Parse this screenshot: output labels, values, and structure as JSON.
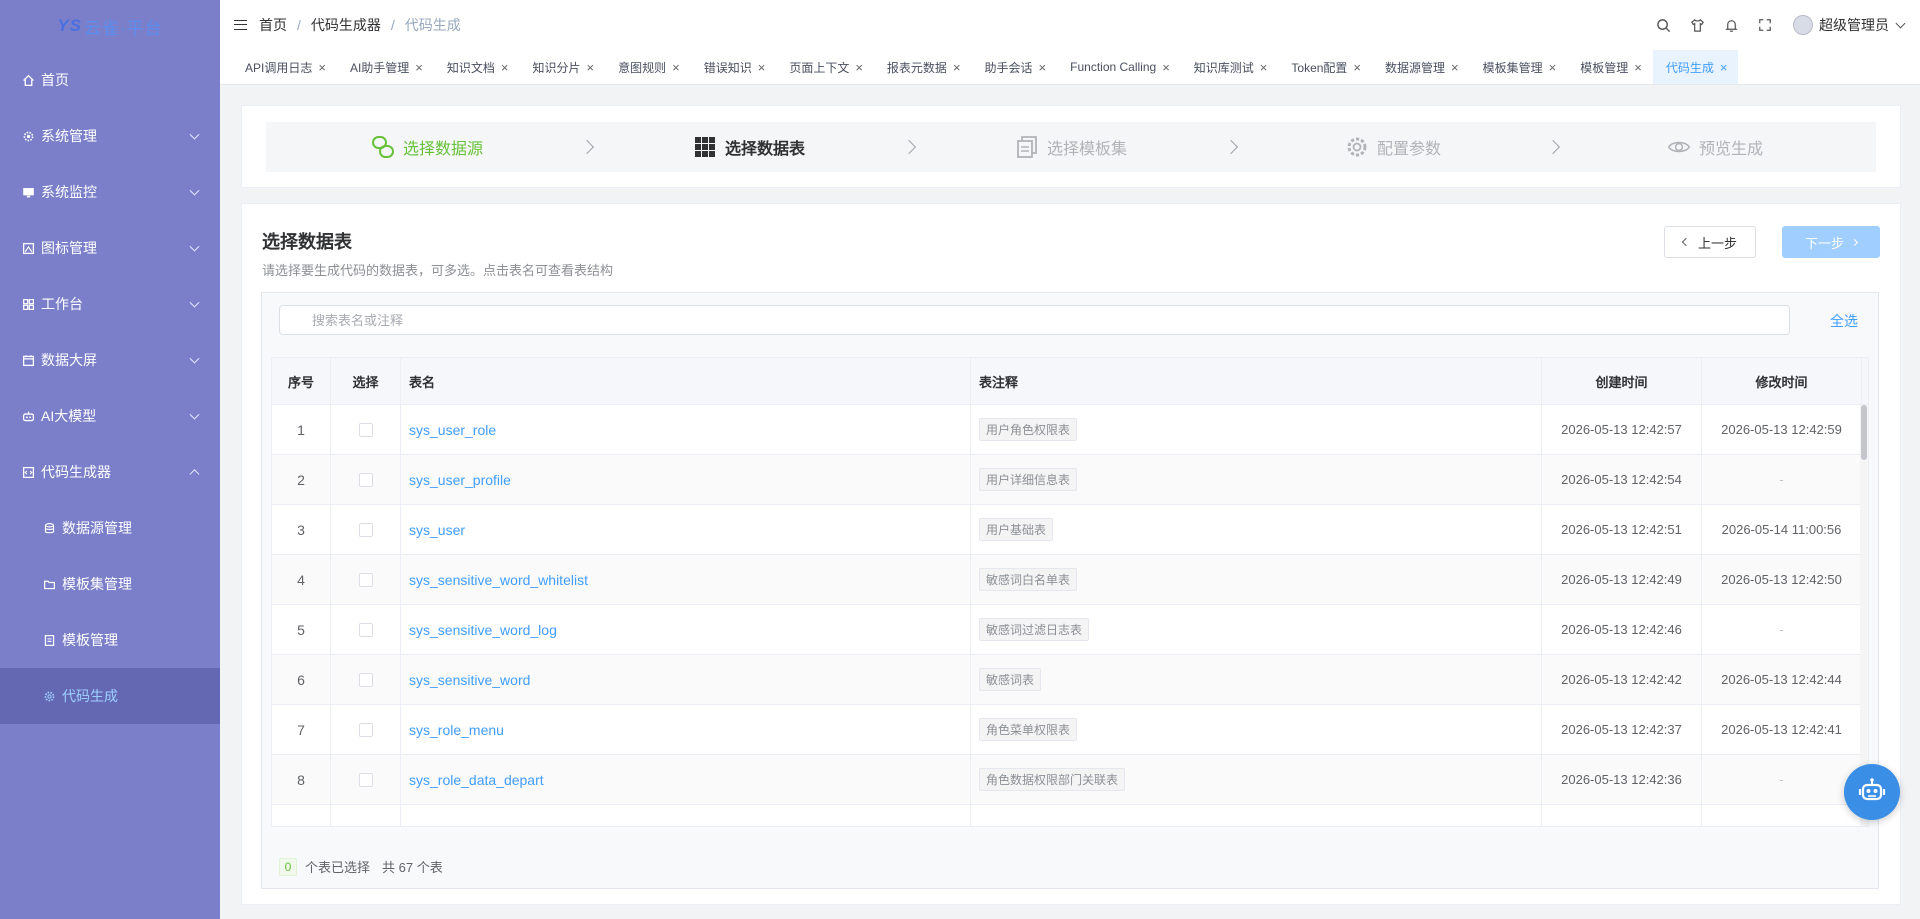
{
  "app": {
    "logo_text": "云雀·平台"
  },
  "sidebar": {
    "items": [
      {
        "label": "首页",
        "icon": "home-icon"
      },
      {
        "label": "系统管理",
        "icon": "gear-icon"
      },
      {
        "label": "系统监控",
        "icon": "monitor-icon"
      },
      {
        "label": "图标管理",
        "icon": "image-icon"
      },
      {
        "label": "工作台",
        "icon": "grid-icon"
      },
      {
        "label": "数据大屏",
        "icon": "calendar-icon"
      },
      {
        "label": "AI大模型",
        "icon": "robot-icon"
      },
      {
        "label": "代码生成器",
        "icon": "code-icon",
        "expanded": true
      }
    ],
    "sub_items": [
      {
        "label": "数据源管理",
        "icon": "database-icon"
      },
      {
        "label": "模板集管理",
        "icon": "folder-icon"
      },
      {
        "label": "模板管理",
        "icon": "document-icon"
      },
      {
        "label": "代码生成",
        "icon": "gear-icon",
        "active": true
      }
    ]
  },
  "header": {
    "breadcrumb": [
      "首页",
      "代码生成器",
      "代码生成"
    ],
    "username": "超级管理员"
  },
  "tags": [
    {
      "label": "API调用日志"
    },
    {
      "label": "AI助手管理"
    },
    {
      "label": "知识文档"
    },
    {
      "label": "知识分片"
    },
    {
      "label": "意图规则"
    },
    {
      "label": "错误知识"
    },
    {
      "label": "页面上下文"
    },
    {
      "label": "报表元数据"
    },
    {
      "label": "助手会话"
    },
    {
      "label": "Function Calling"
    },
    {
      "label": "知识库测试"
    },
    {
      "label": "Token配置"
    },
    {
      "label": "数据源管理"
    },
    {
      "label": "模板集管理"
    },
    {
      "label": "模板管理"
    },
    {
      "label": "代码生成",
      "active": true
    }
  ],
  "steps": [
    {
      "label": "选择数据源",
      "state": "done",
      "icon": "link-icon"
    },
    {
      "label": "选择数据表",
      "state": "current",
      "icon": "table-grid-icon"
    },
    {
      "label": "选择模板集",
      "state": "pending",
      "icon": "copy-icon"
    },
    {
      "label": "配置参数",
      "state": "pending",
      "icon": "gear-icon"
    },
    {
      "label": "预览生成",
      "state": "pending",
      "icon": "eye-icon"
    }
  ],
  "main": {
    "title": "选择数据表",
    "subtitle": "请选择要生成代码的数据表，可多选。点击表名可查看表结构",
    "prev_label": "上一步",
    "next_label": "下一步",
    "search_placeholder": "搜索表名或注释",
    "select_all_label": "全选"
  },
  "table": {
    "columns": [
      "序号",
      "选择",
      "表名",
      "表注释",
      "创建时间",
      "修改时间"
    ],
    "rows": [
      {
        "no": "1",
        "name": "sys_user_role",
        "comment": "用户角色权限表",
        "created": "2026-05-13 12:42:57",
        "modified": "2026-05-13 12:42:59"
      },
      {
        "no": "2",
        "name": "sys_user_profile",
        "comment": "用户详细信息表",
        "created": "2026-05-13 12:42:54",
        "modified": "-"
      },
      {
        "no": "3",
        "name": "sys_user",
        "comment": "用户基础表",
        "created": "2026-05-13 12:42:51",
        "modified": "2026-05-14 11:00:56"
      },
      {
        "no": "4",
        "name": "sys_sensitive_word_whitelist",
        "comment": "敏感词白名单表",
        "created": "2026-05-13 12:42:49",
        "modified": "2026-05-13 12:42:50"
      },
      {
        "no": "5",
        "name": "sys_sensitive_word_log",
        "comment": "敏感词过滤日志表",
        "created": "2026-05-13 12:42:46",
        "modified": "-"
      },
      {
        "no": "6",
        "name": "sys_sensitive_word",
        "comment": "敏感词表",
        "created": "2026-05-13 12:42:42",
        "modified": "2026-05-13 12:42:44"
      },
      {
        "no": "7",
        "name": "sys_role_menu",
        "comment": "角色菜单权限表",
        "created": "2026-05-13 12:42:37",
        "modified": "2026-05-13 12:42:41"
      },
      {
        "no": "8",
        "name": "sys_role_data_depart",
        "comment": "角色数据权限部门关联表",
        "created": "2026-05-13 12:42:36",
        "modified": "-"
      }
    ]
  },
  "footer": {
    "selected_count": "0",
    "selected_suffix": "个表已选择",
    "total_text": "共 67 个表"
  }
}
